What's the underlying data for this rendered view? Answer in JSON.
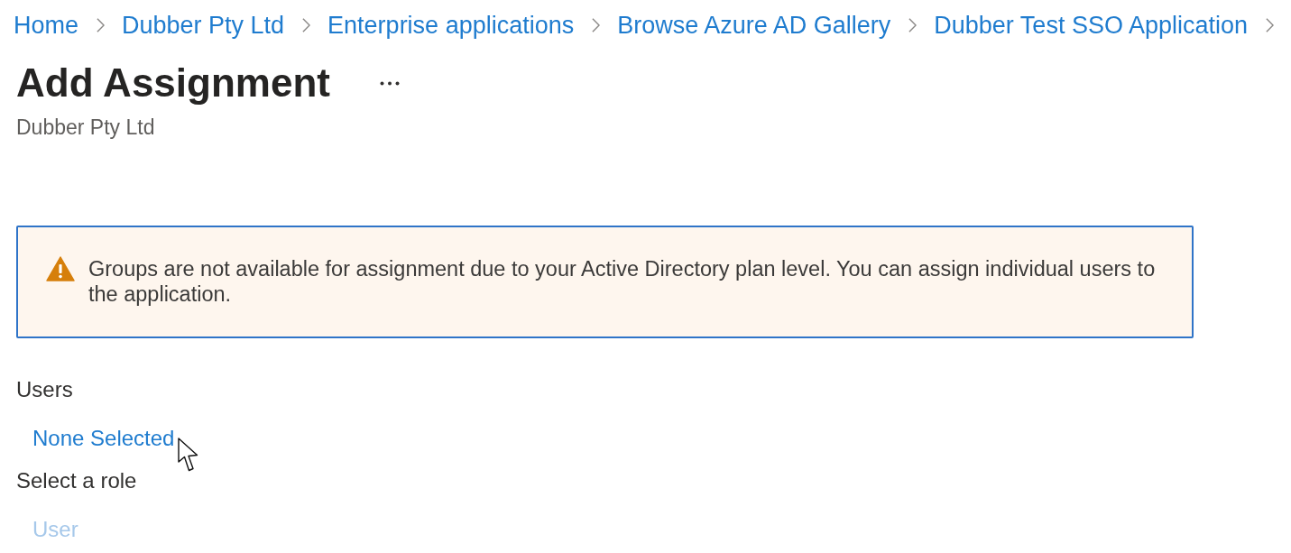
{
  "breadcrumb": [
    "Home",
    "Dubber Pty Ltd",
    "Enterprise applications",
    "Browse Azure AD Gallery",
    "Dubber Test SSO Application"
  ],
  "header": {
    "title": "Add Assignment",
    "subtitle": "Dubber Pty Ltd"
  },
  "notice": {
    "kind": "warning",
    "text": "Groups are not available for assignment due to your Active Directory plan level. You can assign individual users to the application."
  },
  "fields": [
    {
      "label": "Users",
      "value": "None Selected",
      "disabled": false
    },
    {
      "label": "Select a role",
      "value": "User",
      "disabled": true
    }
  ]
}
